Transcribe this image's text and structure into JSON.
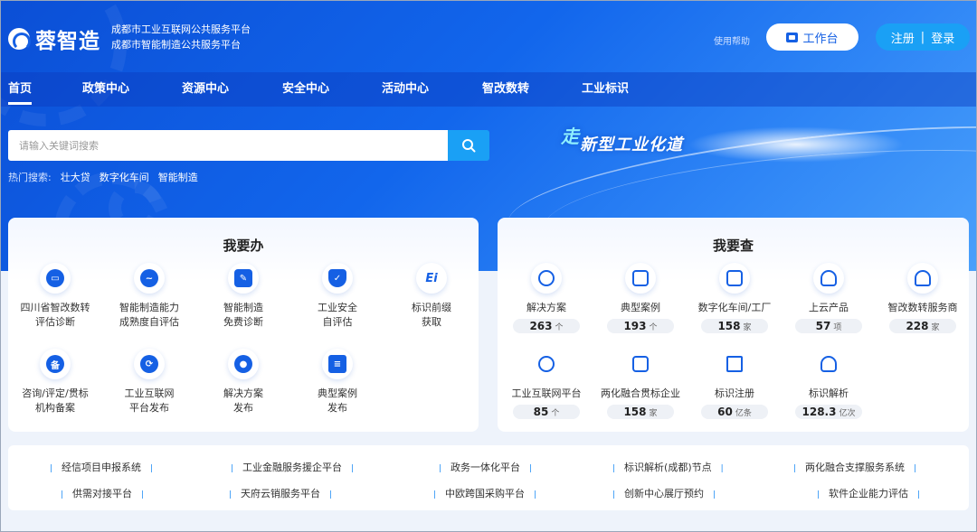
{
  "header": {
    "brand": "蓉智造",
    "subtitle_1": "成都市工业互联网公共服务平台",
    "subtitle_2": "成都市智能制造公共服务平台",
    "help": "使用帮助",
    "workbench": "工作台",
    "register": "注册",
    "login": "登录"
  },
  "nav": [
    "首页",
    "政策中心",
    "资源中心",
    "安全中心",
    "活动中心",
    "智改数转",
    "工业标识"
  ],
  "search": {
    "placeholder": "请输入关键词搜索",
    "hot_label": "热门搜索:",
    "hot_items": [
      "壮大贷",
      "数字化车间",
      "智能制造"
    ]
  },
  "slogan": {
    "char": "走",
    "text": "新型工业化道"
  },
  "do_panel": {
    "title": "我要办",
    "items": [
      {
        "line1": "四川省智改数转",
        "line2": "评估诊断",
        "icon": "diagnosis-icon"
      },
      {
        "line1": "智能制造能力",
        "line2": "成熟度自评估",
        "icon": "chart-icon"
      },
      {
        "line1": "智能制造",
        "line2": "免费诊断",
        "icon": "edit-icon"
      },
      {
        "line1": "工业安全",
        "line2": "自评估",
        "icon": "shield-icon"
      },
      {
        "line1": "标识前缀",
        "line2": "获取",
        "icon": "ei-icon"
      },
      {
        "line1": "咨询/评定/贯标",
        "line2": "机构备案",
        "icon": "record-icon"
      },
      {
        "line1": "工业互联网",
        "line2": "平台发布",
        "icon": "network-icon"
      },
      {
        "line1": "解决方案",
        "line2": "发布",
        "icon": "bulb-icon"
      },
      {
        "line1": "典型案例",
        "line2": "发布",
        "icon": "book-icon"
      }
    ]
  },
  "check_panel": {
    "title": "我要查",
    "items": [
      {
        "label": "解决方案",
        "value": "263",
        "unit": "个",
        "icon": "bulb-icon"
      },
      {
        "label": "典型案例",
        "value": "193",
        "unit": "个",
        "icon": "book-icon"
      },
      {
        "label": "数字化车间/工厂",
        "value": "158",
        "unit": "家",
        "icon": "factory-icon"
      },
      {
        "label": "上云产品",
        "value": "57",
        "unit": "项",
        "icon": "cloud-upload-icon"
      },
      {
        "label": "智改数转服务商",
        "value": "228",
        "unit": "家",
        "icon": "provider-icon"
      },
      {
        "label": "工业互联网平台",
        "value": "85",
        "unit": "个",
        "icon": "hexagon-icon"
      },
      {
        "label": "两化融合贯标企业",
        "value": "158",
        "unit": "家",
        "icon": "link-icon"
      },
      {
        "label": "标识注册",
        "value": "60",
        "unit": "亿条",
        "icon": "register-icon"
      },
      {
        "label": "标识解析",
        "value": "128.3",
        "unit": "亿次",
        "icon": "cloud-network-icon"
      }
    ]
  },
  "links": [
    "经信项目申报系统",
    "工业金融服务援企平台",
    "政务一体化平台",
    "标识解析(成都)节点",
    "两化融合支撑服务系统",
    "供需对接平台",
    "天府云销服务平台",
    "中欧跨国采购平台",
    "创新中心展厅预约",
    "软件企业能力评估"
  ]
}
